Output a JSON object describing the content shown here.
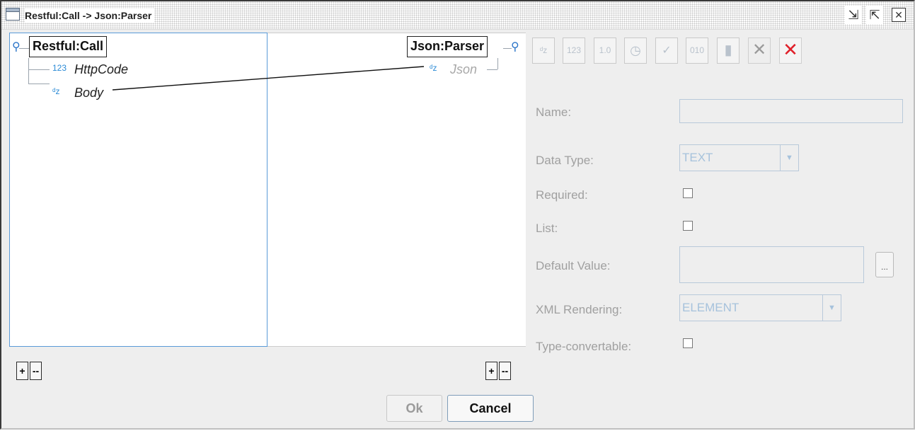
{
  "window": {
    "title": "Restful:Call -> Json:Parser"
  },
  "source_tree": {
    "root_label": "Restful:Call",
    "fields": [
      {
        "type_icon": "123",
        "name": "HttpCode"
      },
      {
        "type_icon": "ᵈz",
        "name": "Body"
      }
    ]
  },
  "target_tree": {
    "root_label": "Json:Parser",
    "fields": [
      {
        "type_icon": "ᵈz",
        "name": "Json"
      }
    ]
  },
  "tree_buttons": {
    "add_label": "+",
    "remove_label": "--"
  },
  "toolbar": [
    {
      "name": "text-type-icon",
      "glyph": "ᵈz"
    },
    {
      "name": "integer-type-icon",
      "glyph": "123"
    },
    {
      "name": "decimal-type-icon",
      "glyph": "1.0"
    },
    {
      "name": "clock-type-icon",
      "glyph": "◷"
    },
    {
      "name": "boolean-type-icon",
      "glyph": "✓"
    },
    {
      "name": "binary-type-icon",
      "glyph": "010"
    },
    {
      "name": "document-type-icon",
      "glyph": "▮"
    },
    {
      "name": "delete-icon",
      "glyph": "✕"
    },
    {
      "name": "delete-all-icon",
      "glyph": "✕"
    }
  ],
  "form": {
    "name_label": "Name:",
    "name_value": "",
    "data_type_label": "Data Type:",
    "data_type_value": "TEXT",
    "required_label": "Required:",
    "list_label": "List:",
    "default_value_label": "Default Value:",
    "default_value": "",
    "default_value_button": "...",
    "xml_rendering_label": "XML Rendering:",
    "xml_rendering_value": "ELEMENT",
    "type_convertable_label": "Type-convertable:"
  },
  "buttons": {
    "ok": "Ok",
    "cancel": "Cancel"
  }
}
